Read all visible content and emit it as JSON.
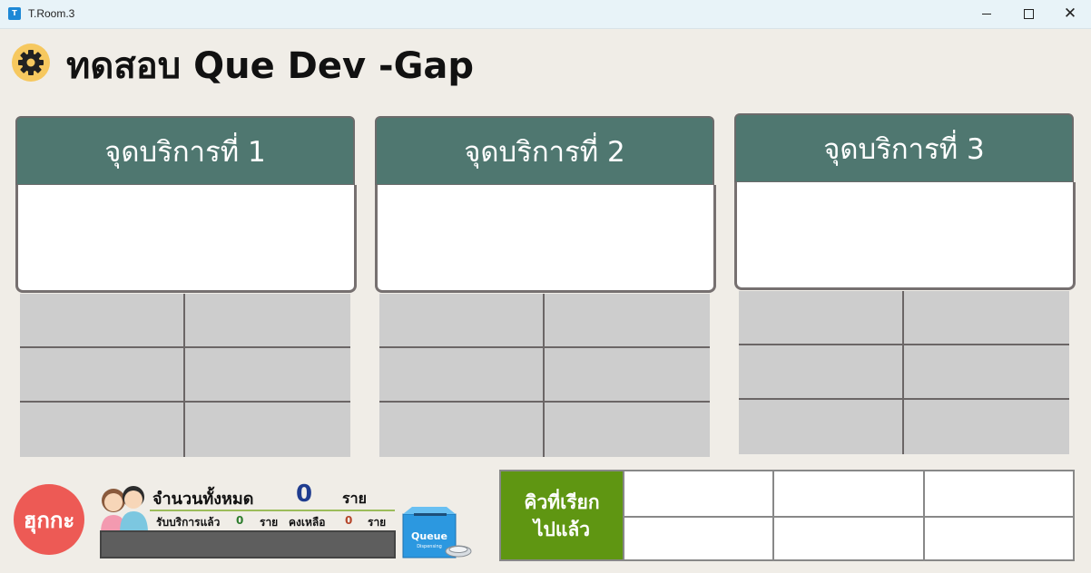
{
  "window": {
    "title": "T.Room.3",
    "icon": "app-icon",
    "controls": [
      "minimize",
      "maximize",
      "close"
    ]
  },
  "header": {
    "title": "ทดสอบ Que Dev -Gap",
    "icon": "gear-icon"
  },
  "stations": [
    {
      "label": "จุดบริการที่ 1"
    },
    {
      "label": "จุดบริการที่ 2"
    },
    {
      "label": "จุดบริการที่ 3"
    }
  ],
  "logo": {
    "text": "ฮุกกะ"
  },
  "stats": {
    "total_label": "จำนวนทั้งหมด",
    "total_value": "0",
    "total_unit": "ราย",
    "served_label": "รับบริการแล้ว",
    "served_value": "0",
    "served_unit": "ราย",
    "remaining_label": "คงเหลือ",
    "remaining_value": "0",
    "remaining_unit": "ราย"
  },
  "queue_box": {
    "title": "Queue",
    "subtitle": "Dispensing"
  },
  "called_queue": {
    "line1": "คิวที่เรียก",
    "line2": "ไปแล้ว"
  },
  "colors": {
    "station_header": "#4f7770",
    "called_label_bg": "#5f9612",
    "logo_bg": "#ed5a55",
    "total_value": "#1f3c8f"
  }
}
